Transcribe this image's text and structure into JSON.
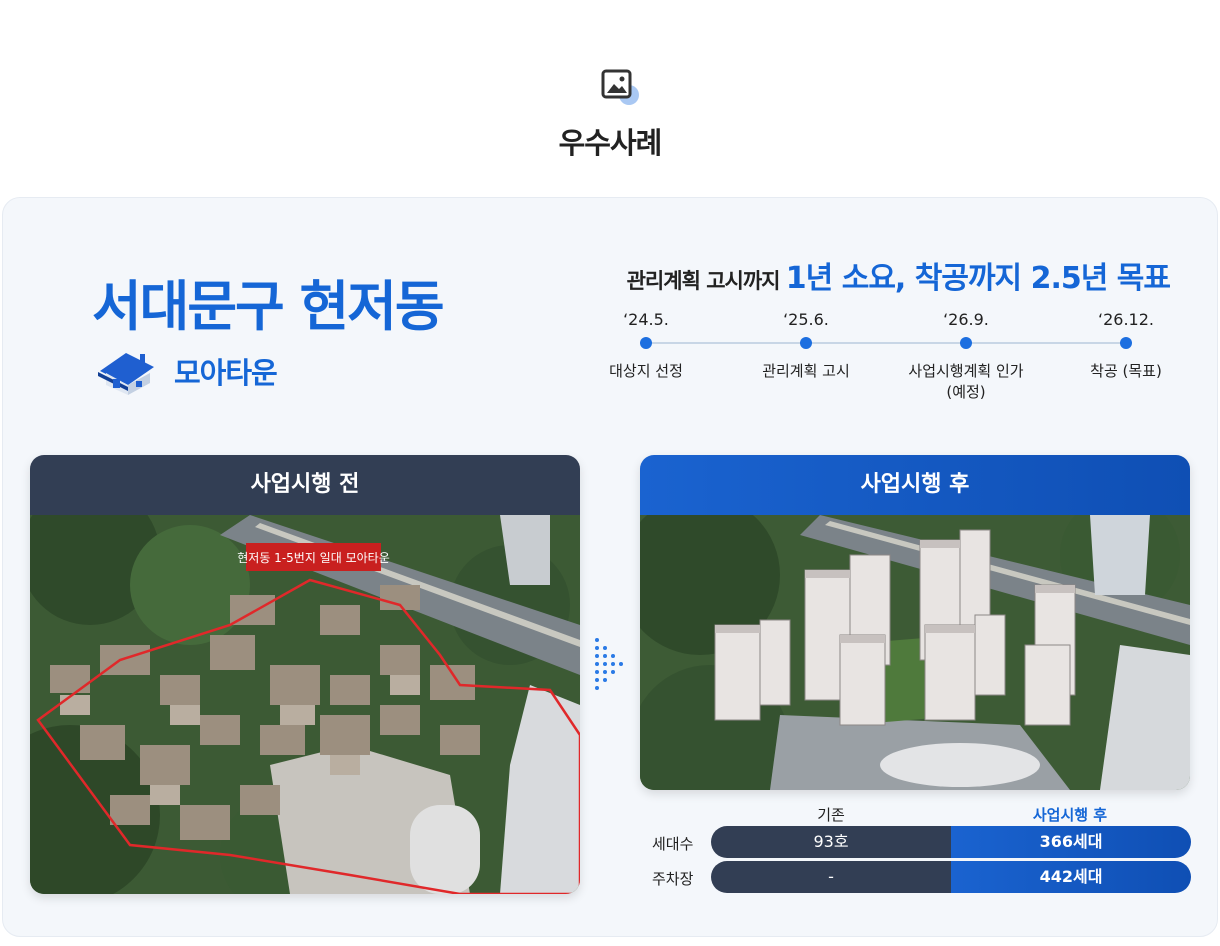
{
  "header": {
    "title": "우수사례",
    "icon": "image-icon"
  },
  "district": {
    "name": "서대문구 현저동",
    "type_label": "모아타운",
    "type_icon": "house-icon"
  },
  "headline": {
    "prefix": "관리계획 고시까지 ",
    "highlight": "1년 소요, 착공까지 2.5년 목표"
  },
  "timeline": [
    {
      "date": "‘24.5.",
      "label": "대상지 선정"
    },
    {
      "date": "‘25.6.",
      "label": "관리계획 고시"
    },
    {
      "date": "‘26.9.",
      "label": "사업시행계획 인가\n(예정)"
    },
    {
      "date": "‘26.12.",
      "label": "착공 (목표)"
    }
  ],
  "before": {
    "title": "사업시행 전",
    "map_label": "현저동 1-5번지 일대 모아타운"
  },
  "after": {
    "title": "사업시행 후"
  },
  "stats": {
    "col_before": "기존",
    "col_after": "사업시행 후",
    "rows": [
      {
        "label": "세대수",
        "before": "93호",
        "after": "366세대"
      },
      {
        "label": "주차장",
        "before": "-",
        "after": "442세대"
      }
    ]
  },
  "colors": {
    "accent": "#1566d6",
    "dark": "#323e54",
    "panel": "#f4f7fb"
  }
}
